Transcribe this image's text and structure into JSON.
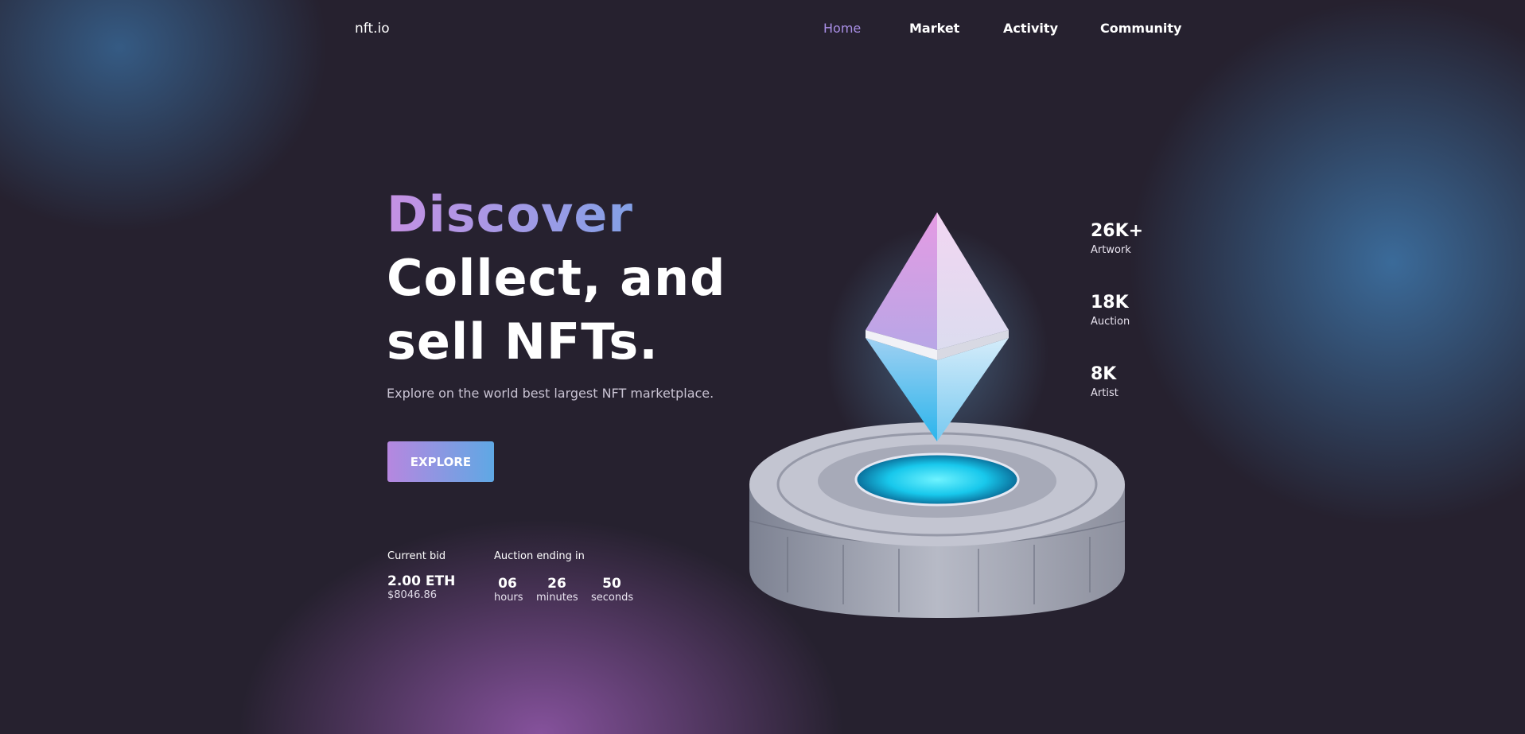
{
  "header": {
    "logo": "nft.io",
    "nav": [
      {
        "label": "Home",
        "active": true
      },
      {
        "label": "Market",
        "active": false
      },
      {
        "label": "Activity",
        "active": false
      },
      {
        "label": "Community",
        "active": false
      }
    ]
  },
  "hero": {
    "headline_gradient": "Discover",
    "headline_line2": "Collect, and",
    "headline_line3": "sell NFTs.",
    "subtitle": "Explore on the world best largest NFT marketplace.",
    "cta_label": "EXPLORE"
  },
  "bid": {
    "current_bid_label": "Current bid",
    "eth": "2.00 ETH",
    "usd": "$8046.86",
    "auction_label": "Auction ending in",
    "countdown": [
      {
        "value": "06",
        "unit": "hours"
      },
      {
        "value": "26",
        "unit": "minutes"
      },
      {
        "value": "50",
        "unit": "seconds"
      }
    ]
  },
  "stats": [
    {
      "value": "26K+",
      "label": "Artwork"
    },
    {
      "value": "18K",
      "label": "Auction"
    },
    {
      "value": "8K",
      "label": "Artist"
    }
  ],
  "colors": {
    "background": "#26212f",
    "nav_active": "#a98fe6",
    "gradient_start": "#b687e0",
    "gradient_end": "#5fa8e4"
  },
  "icons": {
    "illustration": "ethereum-crystal-on-pedestal"
  }
}
